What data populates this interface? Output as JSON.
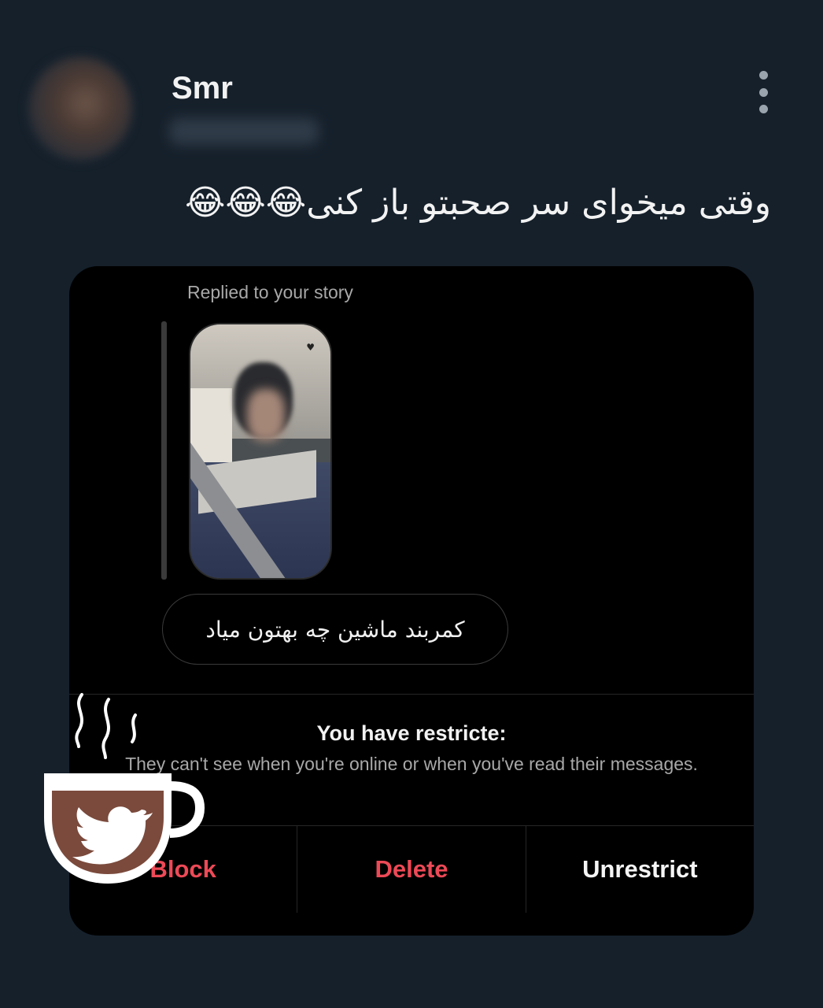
{
  "header": {
    "username": "Smr",
    "more_icon": "more-vertical-icon"
  },
  "tweet": {
    "text": "وقتی میخوای سر صحبتو باز کنی😂😂😂"
  },
  "dm_card": {
    "reply_label": "Replied to your story",
    "story_icon": "heart-icon",
    "message": "کمربند ماشین چه بهتون میاد",
    "restricted_title": "You have restricte:",
    "restricted_desc": "They can't see when you're online or when you've read their messages.",
    "actions": {
      "block": "Block",
      "delete": "Delete",
      "unrestrict": "Unrestrict"
    },
    "colors": {
      "danger": "#ed4956",
      "background": "#000000"
    }
  },
  "watermark": {
    "icon": "coffee-cup-twitter-bird-icon",
    "cup_color": "#7b4a3c"
  },
  "page_colors": {
    "background": "#15202b"
  }
}
